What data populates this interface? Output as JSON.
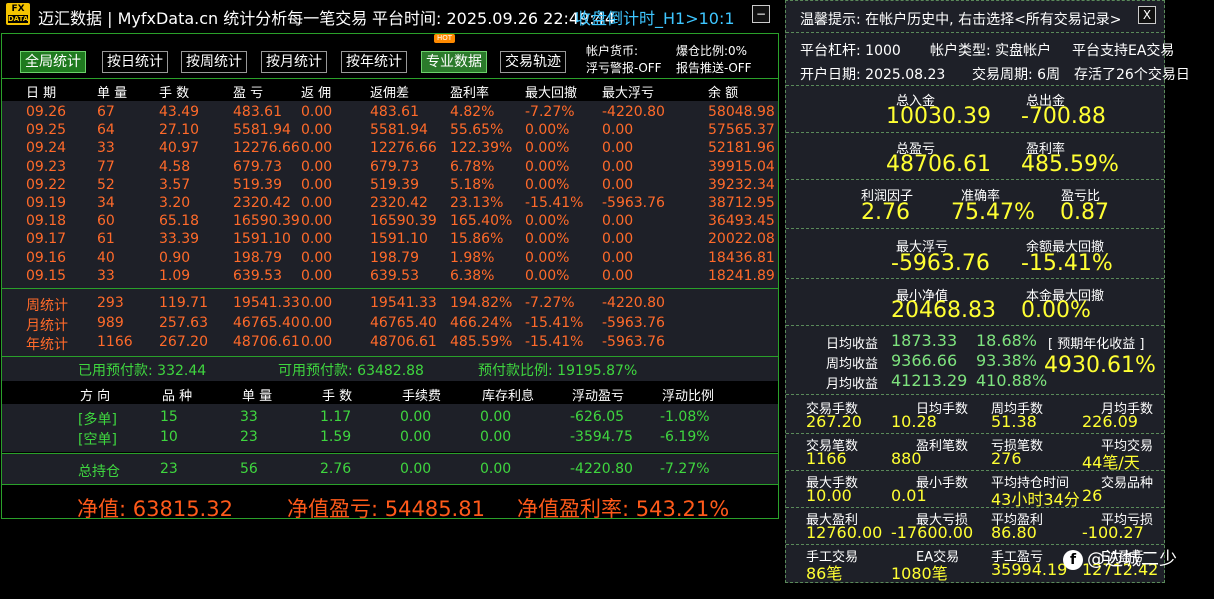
{
  "topbar": {
    "logo_top": "FX",
    "logo_bottom": "DATA",
    "title": "迈汇数据 | MyfxData.cn  统计分析每一笔交易",
    "platform_time": "平台时间:  2025.09.26 22:49:44",
    "countdown": "收盘倒计时_H1>10:1",
    "minimize": "−"
  },
  "right_top": {
    "tip": "温馨提示: 在帐户历史中, 右击选择<所有交易记录>",
    "close": "X"
  },
  "left": {
    "buttons": [
      "全局统计",
      "按日统计",
      "按周统计",
      "按月统计",
      "按年统计",
      "专业数据",
      "交易轨迹"
    ],
    "hot": "HOT",
    "currency": "帐户货币:",
    "float_warning": "浮亏警报-OFF",
    "ratio": "爆仓比例:0%",
    "report": "报告推送-OFF",
    "headers": [
      "日 期",
      "单 量",
      "手 数",
      "盈 亏",
      "返 佣",
      "返佣差",
      "盈利率",
      "最大回撤",
      "最大浮亏",
      "余 额"
    ],
    "daily": [
      [
        "09.26",
        "67",
        "43.49",
        "483.61",
        "0.00",
        "483.61",
        "4.82%",
        "-7.27%",
        "-4220.80",
        "58048.98"
      ],
      [
        "09.25",
        "64",
        "27.10",
        "5581.94",
        "0.00",
        "5581.94",
        "55.65%",
        "0.00%",
        "0.00",
        "57565.37"
      ],
      [
        "09.24",
        "33",
        "40.97",
        "12276.66",
        "0.00",
        "12276.66",
        "122.39%",
        "0.00%",
        "0.00",
        "52181.96"
      ],
      [
        "09.23",
        "77",
        "4.58",
        "679.73",
        "0.00",
        "679.73",
        "6.78%",
        "0.00%",
        "0.00",
        "39915.04"
      ],
      [
        "09.22",
        "52",
        "3.57",
        "519.39",
        "0.00",
        "519.39",
        "5.18%",
        "0.00%",
        "0.00",
        "39232.34"
      ],
      [
        "09.19",
        "34",
        "3.20",
        "2320.42",
        "0.00",
        "2320.42",
        "23.13%",
        "-15.41%",
        "-5963.76",
        "38712.95"
      ],
      [
        "09.18",
        "60",
        "65.18",
        "16590.39",
        "0.00",
        "16590.39",
        "165.40%",
        "0.00%",
        "0.00",
        "36493.45"
      ],
      [
        "09.17",
        "61",
        "33.39",
        "1591.10",
        "0.00",
        "1591.10",
        "15.86%",
        "0.00%",
        "0.00",
        "20022.08"
      ],
      [
        "09.16",
        "40",
        "0.90",
        "198.79",
        "0.00",
        "198.79",
        "1.98%",
        "0.00%",
        "0.00",
        "18436.81"
      ],
      [
        "09.15",
        "33",
        "1.09",
        "639.53",
        "0.00",
        "639.53",
        "6.38%",
        "0.00%",
        "0.00",
        "18241.89"
      ]
    ],
    "summary": [
      [
        "周统计",
        "293",
        "119.71",
        "19541.33",
        "0.00",
        "19541.33",
        "194.82%",
        "-7.27%",
        "-4220.80",
        ""
      ],
      [
        "月统计",
        "989",
        "257.63",
        "46765.40",
        "0.00",
        "46765.40",
        "466.24%",
        "-15.41%",
        "-5963.76",
        ""
      ],
      [
        "年统计",
        "1166",
        "267.20",
        "48706.61",
        "0.00",
        "48706.61",
        "485.59%",
        "-15.41%",
        "-5963.76",
        ""
      ]
    ],
    "margin": {
      "used": "已用预付款: 332.44",
      "available": "可用预付款: 63482.88",
      "ratio": "预付款比例: 19195.87%"
    },
    "pos_headers": [
      "方 向",
      "品 种",
      "单 量",
      "手 数",
      "手续费",
      "库存利息",
      "浮动盈亏",
      "浮动比例"
    ],
    "positions": [
      [
        "[多单]",
        "15",
        "33",
        "1.17",
        "0.00",
        "0.00",
        "-626.05",
        "-1.08%"
      ],
      [
        "[空单]",
        "10",
        "23",
        "1.59",
        "0.00",
        "0.00",
        "-3594.75",
        "-6.19%"
      ]
    ],
    "total": [
      "总持仓",
      "23",
      "56",
      "2.76",
      "0.00",
      "0.00",
      "-4220.80",
      "-7.27%"
    ],
    "equity": {
      "net": "净值:  63815.32",
      "pnl": "净值盈亏:  54485.81",
      "rate": "净值盈利率:  543.21%"
    }
  },
  "right": {
    "leverage": "平台杠杆:  1000",
    "acct_type": "帐户类型:  实盘帐户",
    "ea": "平台支持EA交易",
    "open_date": "开户日期:  2025.08.23",
    "period": "交易周期:  6周",
    "days": "存活了26个交易日",
    "deposit_lbl": "总入金",
    "deposit": "10030.39",
    "withdraw_lbl": "总出金",
    "withdraw": "-700.88",
    "profit_lbl": "总盈亏",
    "profit": "48706.61",
    "rate_lbl": "盈利率",
    "rate": "485.59%",
    "pf_lbl": "利润因子",
    "pf": "2.76",
    "acc_lbl": "准确率",
    "acc": "75.47%",
    "pl_lbl": "盈亏比",
    "pl": "0.87",
    "maxfloat_lbl": "最大浮亏",
    "maxfloat": "-5963.76",
    "baldd_lbl": "余额最大回撤",
    "baldd": "-15.41%",
    "mineq_lbl": "最小净值",
    "mineq": "20468.83",
    "capdd_lbl": "本金最大回撤",
    "capdd": "0.00%",
    "avg": {
      "day_lbl": "日均收益",
      "day": "1873.33",
      "day_pct": "18.68%",
      "week_lbl": "周均收益",
      "week": "9366.66",
      "week_pct": "93.38%",
      "month_lbl": "月均收益",
      "month": "41213.29",
      "month_pct": "410.88%",
      "annual_lbl": "[ 预期年化收益 ]",
      "annual": "4930.61%"
    },
    "stats": [
      [
        "交易手数",
        "267.20",
        "日均手数",
        "10.28",
        "周均手数",
        "51.38",
        "月均手数",
        "226.09"
      ],
      [
        "交易笔数",
        "1166",
        "盈利笔数",
        "880",
        "亏损笔数",
        "276",
        "平均交易",
        "44笔/天"
      ],
      [
        "最大手数",
        "10.00",
        "最小手数",
        "0.01",
        "平均持仓时间",
        "43小时34分",
        "交易品种",
        "26"
      ],
      [
        "最大盈利",
        "12760.00",
        "最大亏损",
        "-17600.00",
        "平均盈利",
        "86.80",
        "平均亏损",
        "-100.27"
      ],
      [
        "手工交易",
        "86笔",
        "EA交易",
        "1080笔",
        "手工盈亏",
        "35994.19",
        "EA盈亏",
        "12712.42"
      ]
    ]
  },
  "watermark": {
    "icon": "f",
    "text": "@边城二少"
  }
}
